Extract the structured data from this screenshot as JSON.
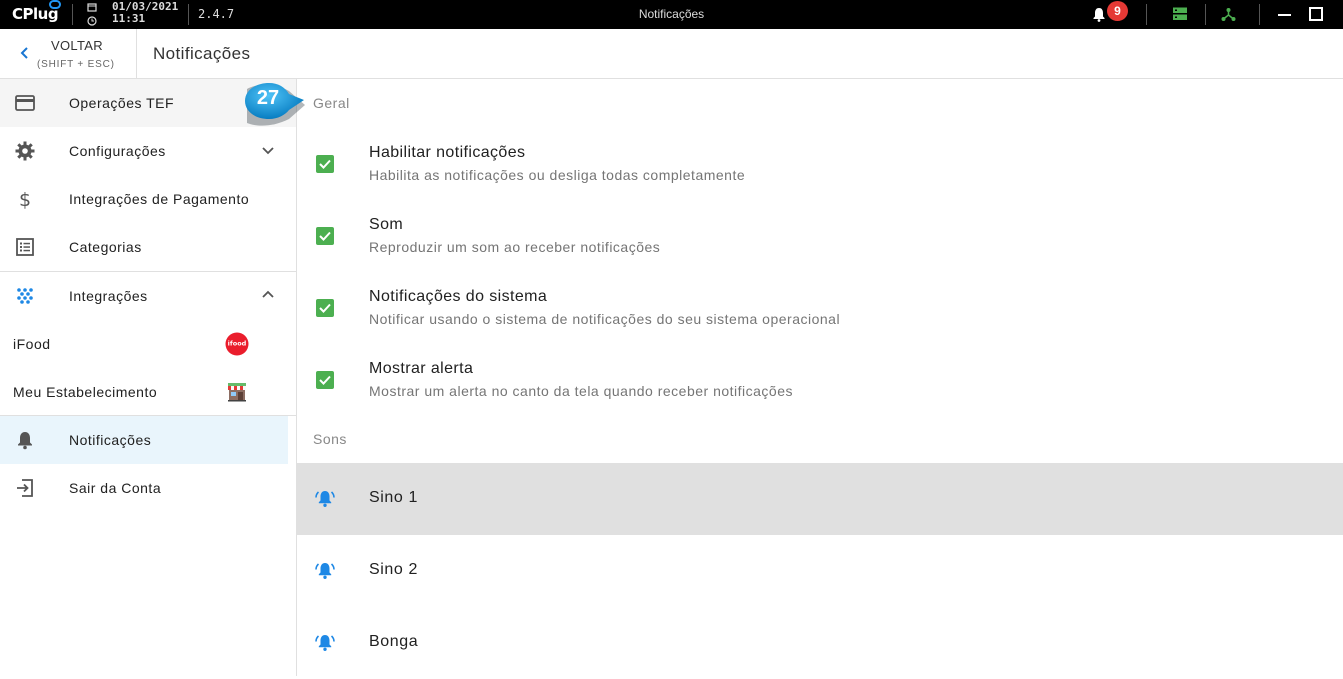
{
  "titlebar": {
    "logo": "CPlug",
    "date": "01/03/2021",
    "time": "11:31",
    "version": "2.4.7",
    "window_title": "Notificações",
    "notification_count": "9"
  },
  "header": {
    "back_label": "VOLTAR",
    "back_shortcut": "(SHIFT + ESC)",
    "page_title": "Notificações"
  },
  "sidebar": {
    "items": [
      {
        "label": "Operações TEF",
        "icon": "credit-card-icon"
      },
      {
        "label": "Configurações",
        "icon": "gear-icon"
      },
      {
        "label": "Integrações de Pagamento",
        "icon": "dollar-icon"
      },
      {
        "label": "Categorias",
        "icon": "list-icon"
      },
      {
        "label": "Integrações",
        "icon": "dots-grid-icon"
      },
      {
        "label": "iFood",
        "icon": "ifood-logo"
      },
      {
        "label": "Meu Estabelecimento",
        "icon": "store-icon"
      },
      {
        "label": "Notificações",
        "icon": "bell-icon"
      },
      {
        "label": "Sair da Conta",
        "icon": "logout-icon"
      }
    ]
  },
  "main": {
    "general_title": "Geral",
    "options": [
      {
        "title": "Habilitar notificações",
        "desc": "Habilita as notificações ou desliga todas completamente",
        "checked": true
      },
      {
        "title": "Som",
        "desc": "Reproduzir um som ao receber notificações",
        "checked": true
      },
      {
        "title": "Notificações do sistema",
        "desc": "Notificar usando o sistema de notificações do seu sistema operacional",
        "checked": true
      },
      {
        "title": "Mostrar alerta",
        "desc": "Mostrar um alerta no canto da tela quando receber notificações",
        "checked": true
      }
    ],
    "sounds_title": "Sons",
    "sounds": [
      {
        "label": "Sino 1",
        "playing": true
      },
      {
        "label": "Sino 2",
        "playing": false
      },
      {
        "label": "Bonga",
        "playing": false
      }
    ]
  },
  "callout": {
    "number": "27"
  },
  "colors": {
    "accent": "#2196f3",
    "check": "#4caf50",
    "badge": "#e53935",
    "selected_bg": "#e9f5fc"
  }
}
